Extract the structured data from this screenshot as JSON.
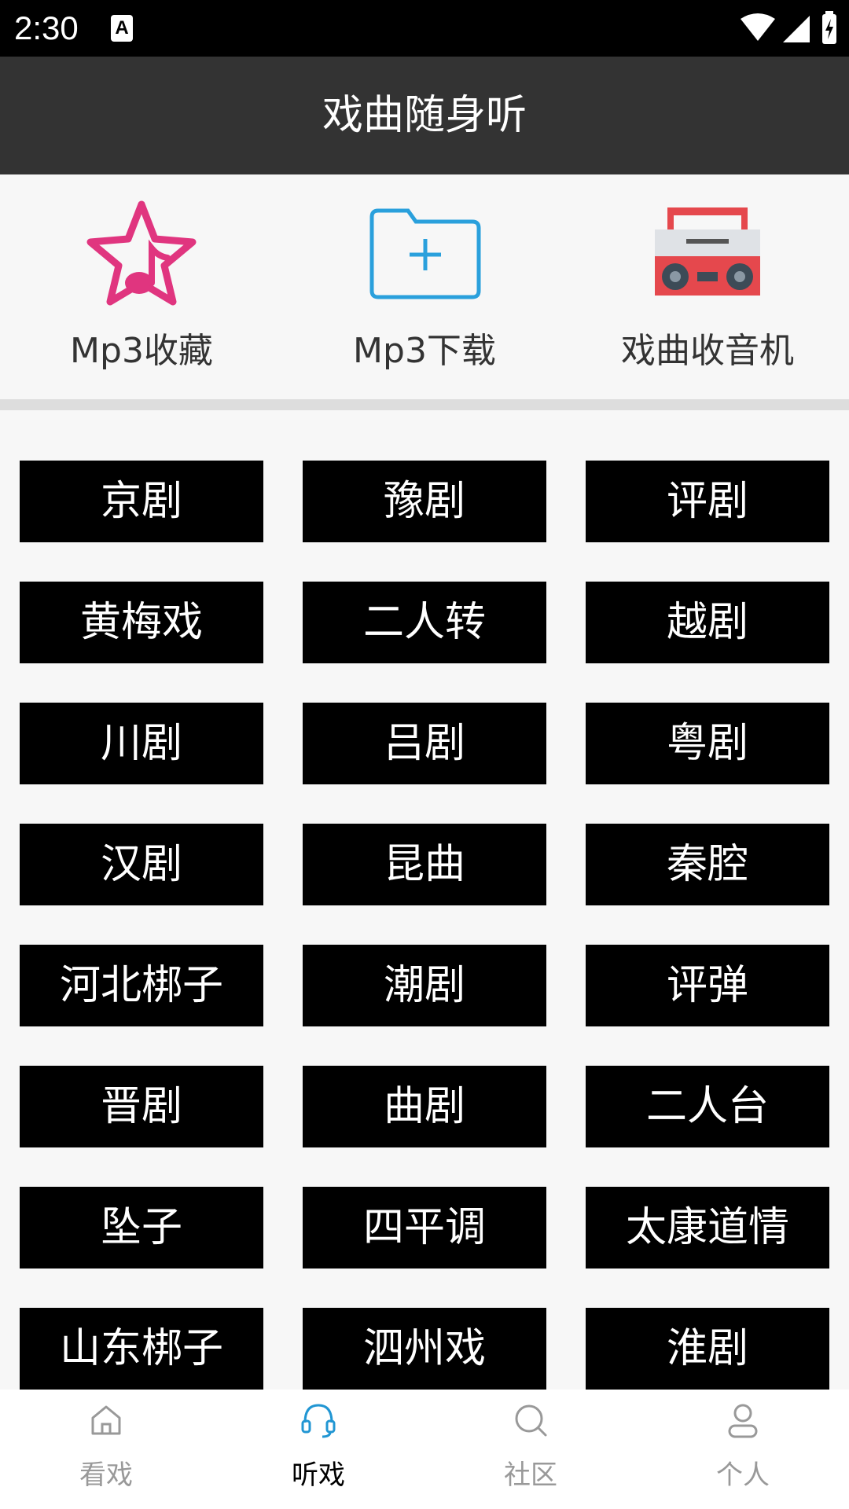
{
  "status_bar": {
    "time": "2:30",
    "notification_badge": "A",
    "icons": [
      "wifi-icon",
      "signal-icon",
      "battery-charging-icon"
    ]
  },
  "header": {
    "title": "戏曲随身听"
  },
  "quick_actions": [
    {
      "label": "Mp3收藏",
      "icon": "star-music-note-icon"
    },
    {
      "label": "Mp3下载",
      "icon": "folder-add-icon"
    },
    {
      "label": "戏曲收音机",
      "icon": "boombox-radio-icon"
    }
  ],
  "genres": [
    "京剧",
    "豫剧",
    "评剧",
    "黄梅戏",
    "二人转",
    "越剧",
    "川剧",
    "吕剧",
    "粤剧",
    "汉剧",
    "昆曲",
    "秦腔",
    "河北梆子",
    "潮剧",
    "评弹",
    "晋剧",
    "曲剧",
    "二人台",
    "坠子",
    "四平调",
    "太康道情",
    "山东梆子",
    "泗州戏",
    "淮剧"
  ],
  "bottom_nav": {
    "items": [
      {
        "label": "看戏",
        "icon": "home-icon"
      },
      {
        "label": "听戏",
        "icon": "headset-icon"
      },
      {
        "label": "社区",
        "icon": "search-icon"
      },
      {
        "label": "个人",
        "icon": "person-icon"
      }
    ],
    "active_index": 1
  },
  "colors": {
    "header_bg": "#333333",
    "accent_active": "#2196d3",
    "genre_button_bg": "#000000",
    "favorites_pink": "#e0357f",
    "download_blue": "#2aa0dc",
    "radio_red": "#e5484d"
  }
}
